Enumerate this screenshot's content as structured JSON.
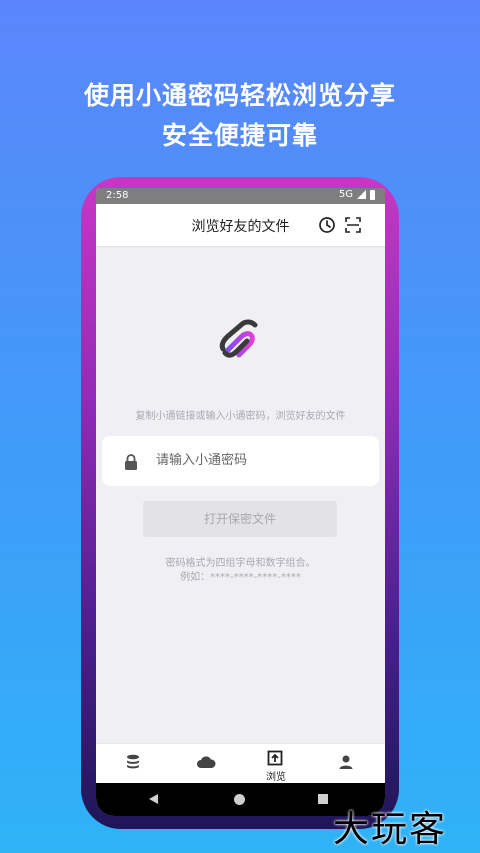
{
  "promo": {
    "line1": "使用小通密码轻松浏览分享",
    "line2": "安全便捷可靠"
  },
  "status": {
    "time": "2:58",
    "network": "5G"
  },
  "appbar": {
    "title": "浏览好友的文件",
    "history_icon": "clock-icon",
    "scan_icon": "scan-icon"
  },
  "main": {
    "hint": "复制小通链接或输入小通密码，浏览好友的文件",
    "password_placeholder": "请输入小通密码",
    "password_value": "",
    "open_button": "打开保密文件",
    "format_line1": "密码格式为四组字母和数字组合。",
    "format_line2": "例如：****-****-****-****"
  },
  "bottom_nav": {
    "items": [
      {
        "label": "",
        "icon": "database-icon"
      },
      {
        "label": "",
        "icon": "cloud-icon"
      },
      {
        "label": "浏览",
        "icon": "browse-icon"
      },
      {
        "label": "",
        "icon": "person-icon"
      }
    ]
  },
  "colors": {
    "background_top": "#5b86fb",
    "background_bottom": "#2fb3f7",
    "frame_top": "#c737c4",
    "frame_bottom": "#1e1657",
    "screen_bg": "#efeff4"
  },
  "watermark": "大玩客"
}
